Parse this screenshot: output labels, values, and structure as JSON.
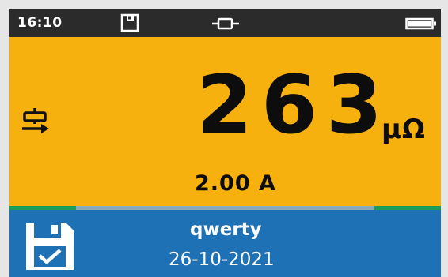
{
  "status_bar": {
    "time": "16:10",
    "icons": [
      "save-icon",
      "connector-icon",
      "battery-icon"
    ]
  },
  "reading": {
    "value": "263",
    "unit": "μΩ",
    "current": "2.00 A",
    "mode_icon": "resistance-probe-icon"
  },
  "save_panel": {
    "name": "qwerty",
    "date": "26-10-2021",
    "icon": "save-check-icon"
  },
  "colors": {
    "status_bg": "#2b2b2b",
    "reading_bg": "#f7b10f",
    "save_bg": "#1f71b5",
    "strip_green": "#1f9a57"
  }
}
